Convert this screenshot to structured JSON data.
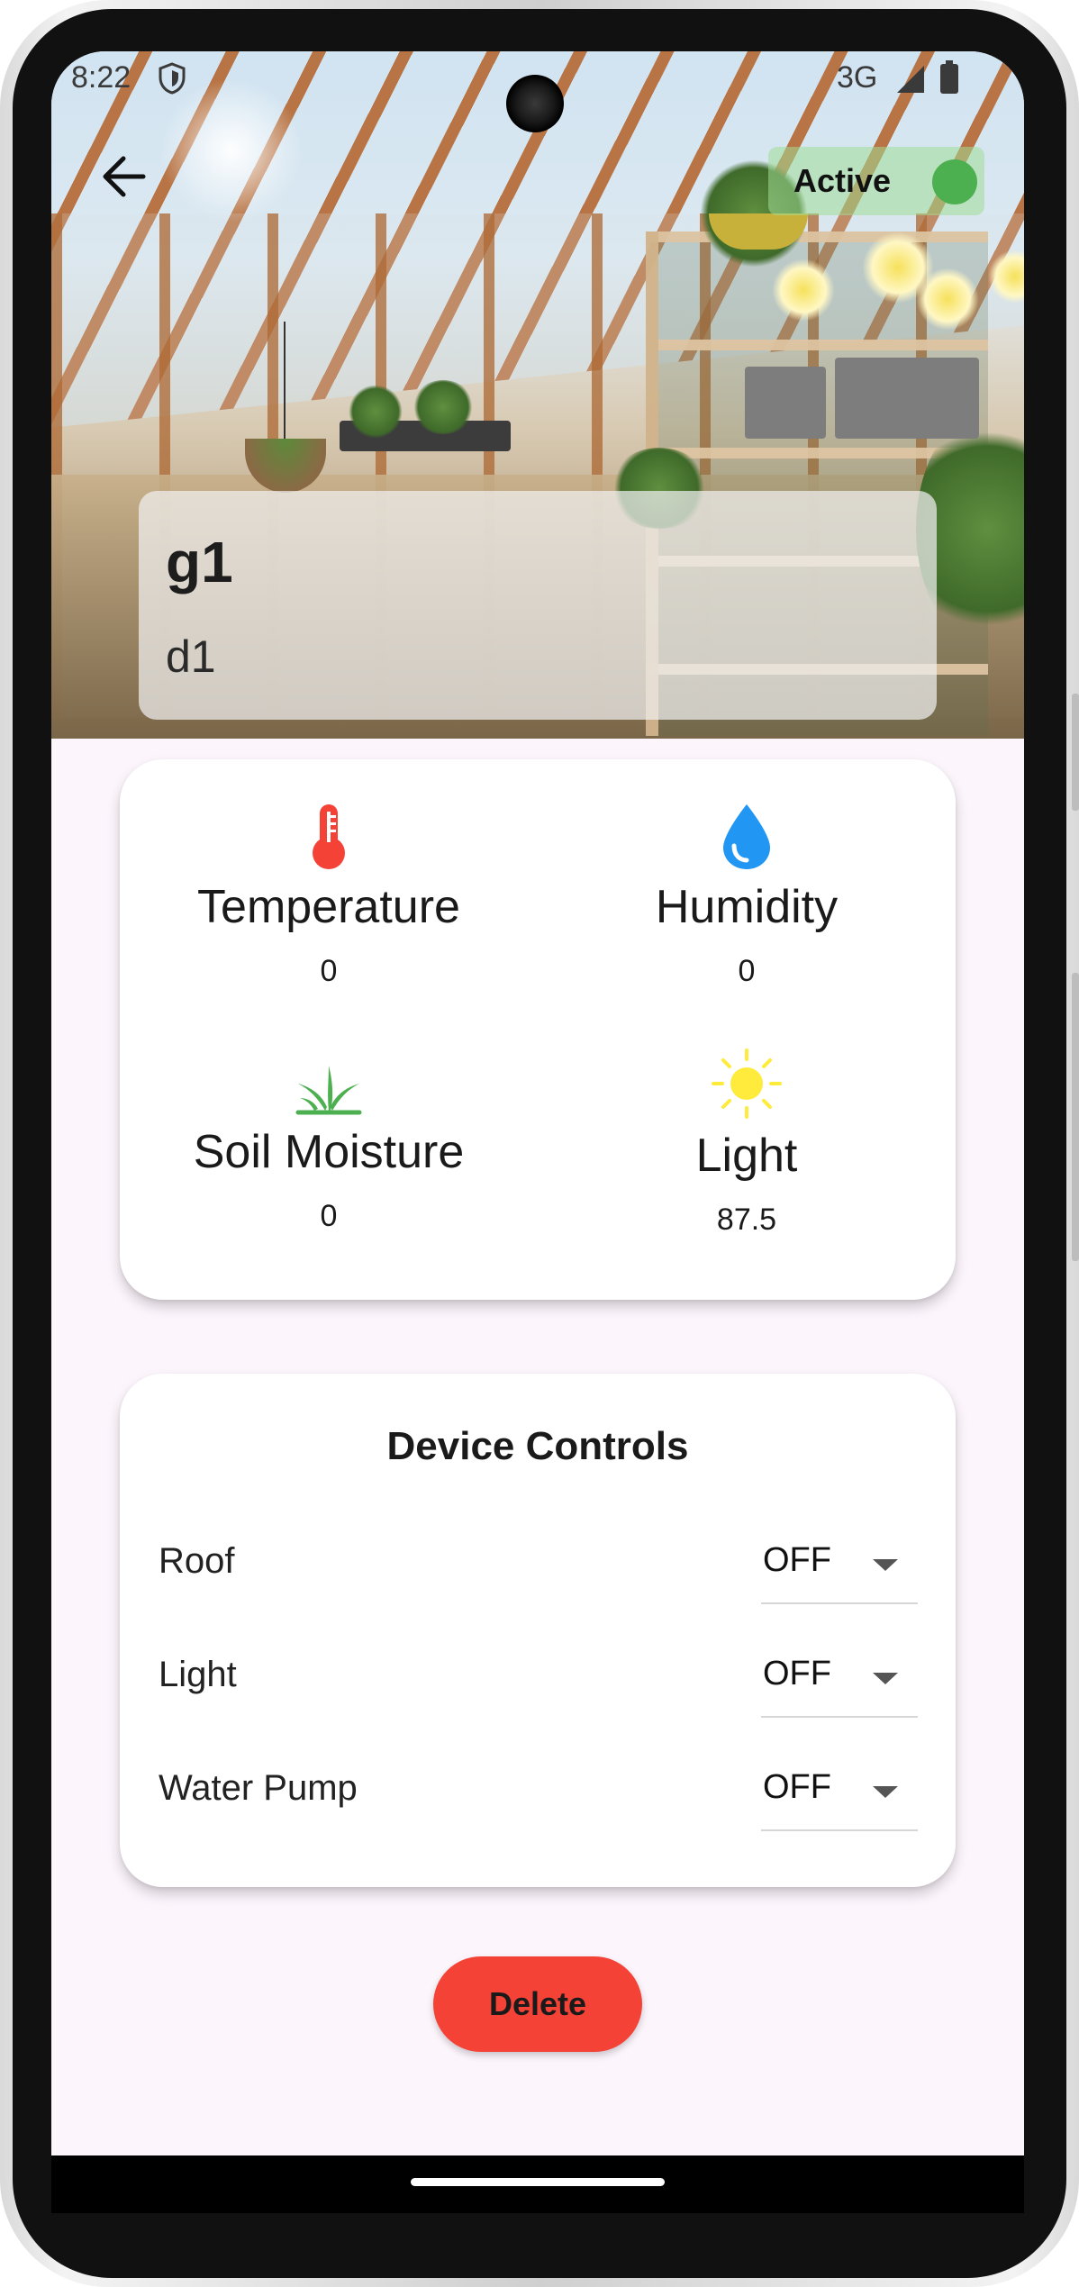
{
  "status_bar": {
    "time": "8:22",
    "network": "3G",
    "shield_icon": "shield-icon",
    "signal_icon": "signal-icon",
    "battery_icon": "battery-icon"
  },
  "header": {
    "back_icon": "arrow-back-icon",
    "status_label": "Active",
    "status_color": "#4caf50",
    "greenhouse_name": "g1",
    "device_name": "d1"
  },
  "sensors": [
    {
      "label": "Temperature",
      "value": "0",
      "icon": "thermometer-icon",
      "color": "#f44336"
    },
    {
      "label": "Humidity",
      "value": "0",
      "icon": "water-drop-icon",
      "color": "#2196f3"
    },
    {
      "label": "Soil Moisture",
      "value": "0",
      "icon": "grass-icon",
      "color": "#4caf50"
    },
    {
      "label": "Light",
      "value": "87.5",
      "icon": "sun-icon",
      "color": "#ffeb3b"
    }
  ],
  "controls": {
    "title": "Device Controls",
    "items": [
      {
        "label": "Roof",
        "value": "OFF"
      },
      {
        "label": "Light",
        "value": "OFF"
      },
      {
        "label": "Water Pump",
        "value": "OFF"
      }
    ]
  },
  "actions": {
    "delete_label": "Delete",
    "delete_color": "#f44336"
  },
  "theme": {
    "background": "#fcf5fc",
    "card": "#ffffff"
  }
}
